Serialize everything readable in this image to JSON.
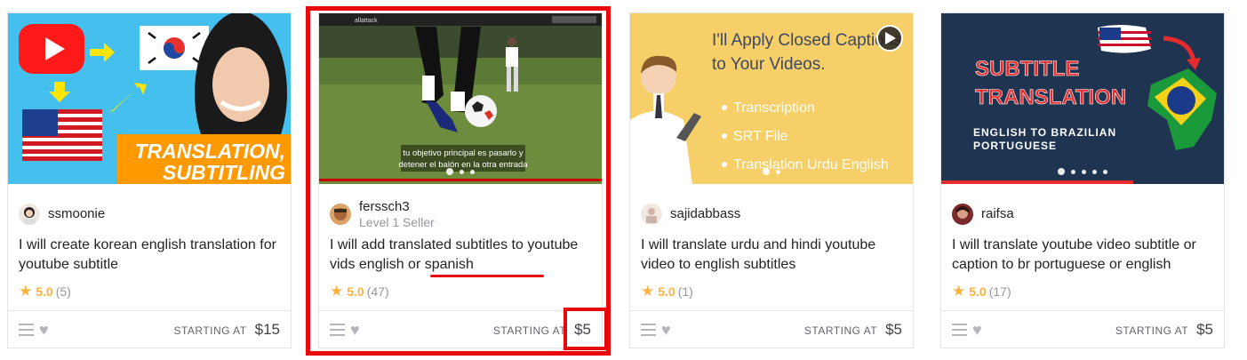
{
  "cards": [
    {
      "seller": "ssmoonie",
      "level": "",
      "title": "I will create korean english translation for youtube subtitle",
      "rating": "5.0",
      "reviews": "(5)",
      "starting_label": "STARTING AT",
      "price": "$15",
      "thumb_text": [
        "TRANSLATION,",
        "SUBTITLING"
      ]
    },
    {
      "seller": "ferssch3",
      "level": "Level 1 Seller",
      "title": "I will add translated subtitles to youtube vids english or spanish",
      "rating": "5.0",
      "reviews": "(47)",
      "starting_label": "STARTING AT",
      "price": "$5",
      "thumb_text": [
        "allattack",
        "tu objetivo principal es pasarlo y",
        "detener el balón en la otra entrada"
      ]
    },
    {
      "seller": "sajidabbass",
      "level": "",
      "title": "I will translate urdu and hindi youtube video to english subtitles",
      "rating": "5.0",
      "reviews": "(1)",
      "starting_label": "STARTING AT",
      "price": "$5",
      "thumb_text": [
        "I'll Apply Closed Captions",
        "to Your Videos.",
        "Transcription",
        "SRT File",
        "Translation Urdu English"
      ]
    },
    {
      "seller": "raifsa",
      "level": "",
      "title": "I will translate youtube video subtitle or caption to br portuguese or english",
      "rating": "5.0",
      "reviews": "(17)",
      "starting_label": "STARTING AT",
      "price": "$5",
      "thumb_text": [
        "SUBTITLE",
        "TRANSLATION",
        "ENGLISH TO BRAZILIAN",
        "PORTUGUESE"
      ]
    }
  ],
  "colors": {
    "star": "#ffb33e",
    "highlight": "#e8090d",
    "border": "#e4e5e7"
  },
  "icons": [
    "menu-icon",
    "heart-icon",
    "star-icon",
    "play-icon"
  ]
}
